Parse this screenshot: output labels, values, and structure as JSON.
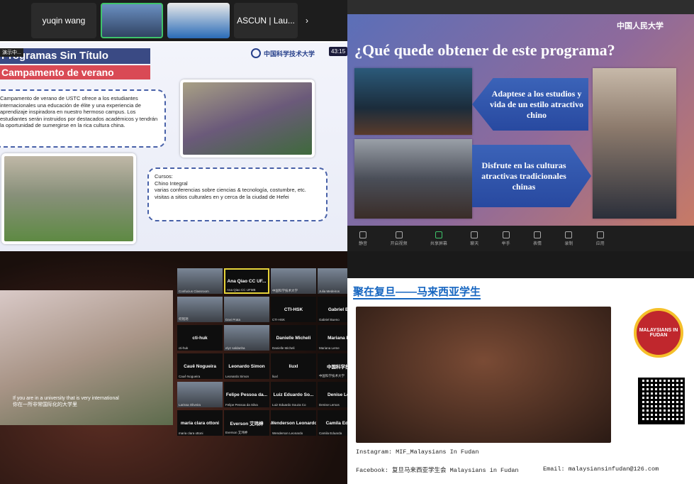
{
  "q1": {
    "participants": [
      "yuqin wang",
      "ASCUN | Lau..."
    ],
    "chevron": "›",
    "rec": "演示中...",
    "timer": "43:15",
    "title1": "Programas Sin Título",
    "title2": "Campamento de verano",
    "logo": "中国科学技术大学",
    "desc": "Campamento de verano de USTC ofrece a los estudiantes internacionales una educación de élite y una experiencia de aprendizaje inspiradora en nuestro hermoso campus. Los estudiantes serán instruidos por destacados académicos y tendrán la oportunidad de sumergirse en la rica cultura china.",
    "courses_head": "Cursos:",
    "courses": [
      "Chino Integral",
      "varias conferencias sobre ciencias & tecnología, costumbre, etc.",
      "visitas a sitios culturales en y cerca de la ciudad de Hefei"
    ]
  },
  "q2": {
    "title": "¿Qué quede obtener de este programa?",
    "logo": "中国人民大学",
    "box1": "Adaptese a los estudios y vida de un estilo atractivo chino",
    "box2": "Disfrute en las culturas atractivas tradicionales chinas",
    "toolbar": [
      "静音",
      "开启视频",
      "共享屏幕",
      "聊天",
      "举手",
      "表情",
      "录制",
      "应用"
    ]
  },
  "q3": {
    "subtitle1": "If you are in a university that is very international",
    "subtitle2": "你在一所非常国际化的大学里",
    "tiles": [
      {
        "name": "",
        "sub": "Confucius Classroom"
      },
      {
        "name": "Ana Qiao CC UF...",
        "sub": "Ana Qiao CC UFMB"
      },
      {
        "name": "",
        "sub": "中国科学技术大学"
      },
      {
        "name": "",
        "sub": "Julia Medeiros"
      },
      {
        "name": "",
        "sub": "何铭玥"
      },
      {
        "name": "",
        "sub": "Davi Prata"
      },
      {
        "name": "CTI-HSK",
        "sub": "CTI-HSK"
      },
      {
        "name": "Gabriel B...",
        "sub": "Gabriel Bueno"
      },
      {
        "name": "cti-huk",
        "sub": "cti-huk"
      },
      {
        "name": "",
        "sub": "elyz saldanha"
      },
      {
        "name": "Danielle Micheli",
        "sub": "Danielle Micheli"
      },
      {
        "name": "Mariana L...",
        "sub": "Mariana Leme"
      },
      {
        "name": "Cauê Nogueira",
        "sub": "Cauê Nogueira"
      },
      {
        "name": "Leonardo Simon",
        "sub": "Leonardo Simon"
      },
      {
        "name": "liuxl",
        "sub": "liuxl"
      },
      {
        "name": "中国科学技...",
        "sub": "中国科学技术大学"
      },
      {
        "name": "",
        "sub": "Larissa Oliveira"
      },
      {
        "name": "Felipe Pessoa da...",
        "sub": "Felipe Pessoa da Silva"
      },
      {
        "name": "Luiz Eduardo So...",
        "sub": "Luiz Eduardo Souza Co"
      },
      {
        "name": "Denise Le...",
        "sub": "Denise Lemos"
      },
      {
        "name": "maria clara ottoni",
        "sub": "maria clara ottoni"
      },
      {
        "name": "Everson 艾玮绅",
        "sub": "Everson 艾玮绅"
      },
      {
        "name": "Wenderson Leonardo",
        "sub": "Wenderson Leonardo"
      },
      {
        "name": "Camila Edu...",
        "sub": "Camila Eduarda"
      }
    ]
  },
  "q4": {
    "title": "聚在复旦——马来西亚学生",
    "logo_text": "MALAYSIANS IN FUDAN",
    "instagram": "Instagram: MIF_Malaysians In Fudan",
    "facebook": "Facebook: 复旦马来西亚学生会 Malaysians in Fudan",
    "email": "Email: malaysiansinfudan@126.com"
  }
}
